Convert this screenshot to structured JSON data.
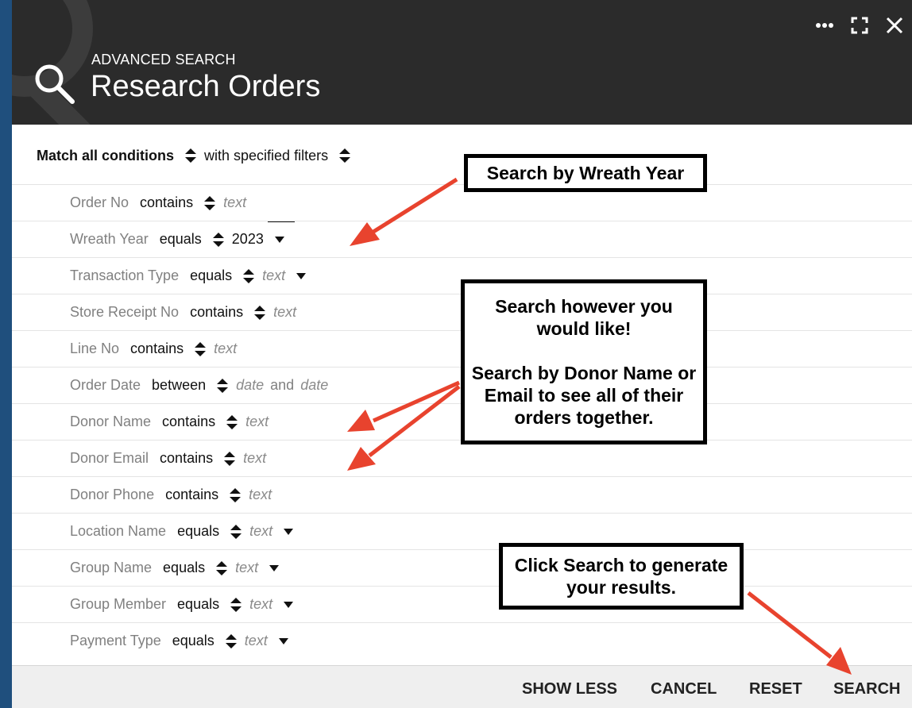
{
  "header": {
    "subtitle": "ADVANCED SEARCH",
    "title": "Research Orders",
    "controls": [
      "more-icon",
      "expand-icon",
      "close-icon"
    ]
  },
  "match": {
    "mode": "Match all conditions",
    "filter_mode": "with specified filters"
  },
  "filters": [
    {
      "label": "Order No",
      "operator": "contains",
      "value": "text"
    },
    {
      "label": "Wreath Year",
      "operator": "equals",
      "value": "2023",
      "dropdown": true
    },
    {
      "label": "Transaction Type",
      "operator": "equals",
      "value": "text",
      "dropdown": true
    },
    {
      "label": "Store Receipt No",
      "operator": "contains",
      "value": "text"
    },
    {
      "label": "Line No",
      "operator": "contains",
      "value": "text"
    },
    {
      "label": "Order Date",
      "operator": "between",
      "value": "date",
      "conjunction": "and",
      "value2": "date"
    },
    {
      "label": "Donor Name",
      "operator": "contains",
      "value": "text"
    },
    {
      "label": "Donor Email",
      "operator": "contains",
      "value": "text"
    },
    {
      "label": "Donor Phone",
      "operator": "contains",
      "value": "text"
    },
    {
      "label": "Location Name",
      "operator": "equals",
      "value": "text",
      "dropdown": true
    },
    {
      "label": "Group Name",
      "operator": "equals",
      "value": "text",
      "dropdown": true
    },
    {
      "label": "Group Member",
      "operator": "equals",
      "value": "text",
      "dropdown": true
    },
    {
      "label": "Payment Type",
      "operator": "equals",
      "value": "text",
      "dropdown": true
    }
  ],
  "footer": {
    "show_less": "SHOW LESS",
    "cancel": "CANCEL",
    "reset": "RESET",
    "search": "SEARCH"
  },
  "callouts": {
    "wreath_year": "Search by Wreath Year",
    "search_any_1": "Search however you would like!",
    "search_any_2": "Search by Donor Name or Email to see all of their orders together.",
    "click_search": "Click Search to generate your results."
  },
  "colors": {
    "background": "#1f4f7d",
    "header": "#2b2b2b",
    "arrow": "#e8432e"
  }
}
